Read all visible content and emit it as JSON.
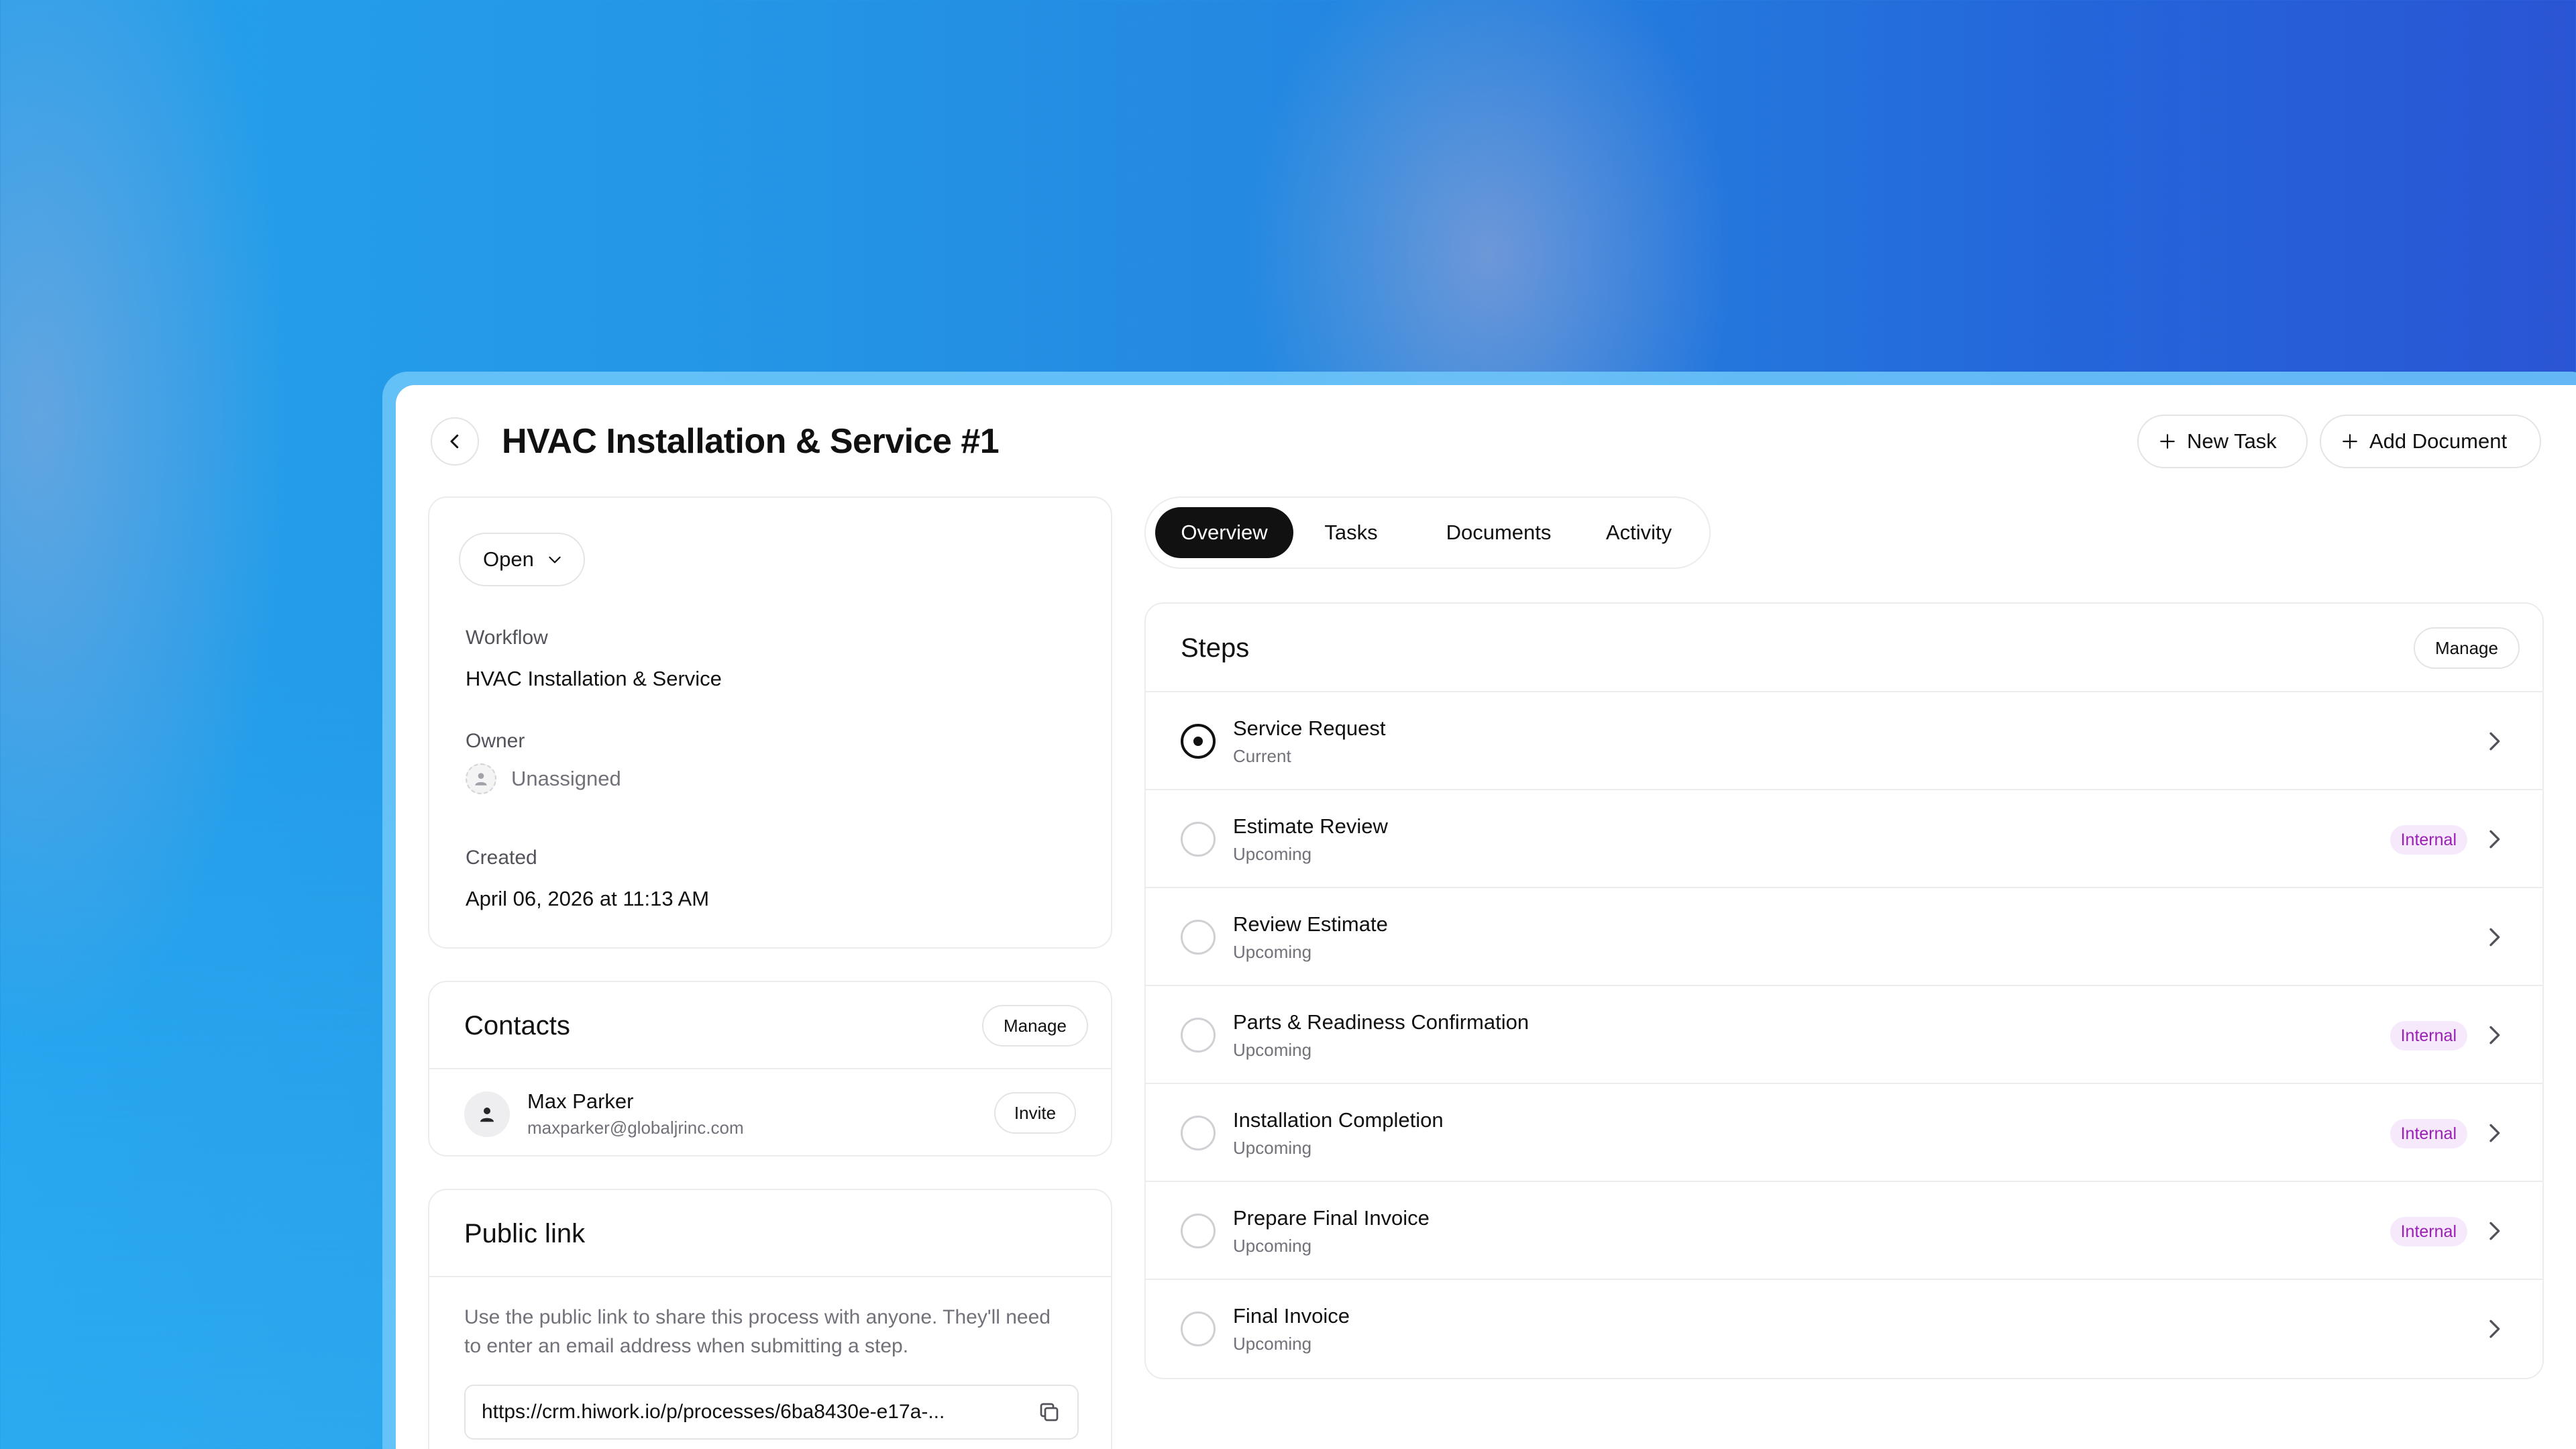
{
  "header": {
    "title": "HVAC Installation & Service #1",
    "new_task_label": "New Task",
    "add_document_label": "Add Document"
  },
  "info": {
    "status": "Open",
    "workflow_label": "Workflow",
    "workflow_value": "HVAC Installation & Service",
    "owner_label": "Owner",
    "owner_value": "Unassigned",
    "created_label": "Created",
    "created_value": "April 06, 2026 at 11:13 AM"
  },
  "contacts": {
    "title": "Contacts",
    "manage_label": "Manage",
    "items": [
      {
        "name": "Max Parker",
        "email": "maxparker@globaljrinc.com",
        "invite_label": "Invite"
      }
    ]
  },
  "public_link": {
    "title": "Public link",
    "description": "Use the public link to share this process with anyone. They'll need to enter an email address when submitting a step.",
    "url": "https://crm.hiwork.io/p/processes/6ba8430e-e17a-..."
  },
  "tabs": [
    {
      "label": "Overview",
      "active": true
    },
    {
      "label": "Tasks",
      "active": false
    },
    {
      "label": "Documents",
      "active": false
    },
    {
      "label": "Activity",
      "active": false
    }
  ],
  "steps": {
    "title": "Steps",
    "manage_label": "Manage",
    "items": [
      {
        "name": "Service Request",
        "status": "Current",
        "badge": ""
      },
      {
        "name": "Estimate Review",
        "status": "Upcoming",
        "badge": "Internal"
      },
      {
        "name": "Review Estimate",
        "status": "Upcoming",
        "badge": ""
      },
      {
        "name": "Parts & Readiness Confirmation",
        "status": "Upcoming",
        "badge": "Internal"
      },
      {
        "name": "Installation Completion",
        "status": "Upcoming",
        "badge": "Internal"
      },
      {
        "name": "Prepare Final Invoice",
        "status": "Upcoming",
        "badge": "Internal"
      },
      {
        "name": "Final Invoice",
        "status": "Upcoming",
        "badge": ""
      }
    ]
  },
  "colors": {
    "accent": "#111111",
    "internal_badge_bg": "#f6e9fb",
    "internal_badge_text": "#9a1fb5"
  }
}
